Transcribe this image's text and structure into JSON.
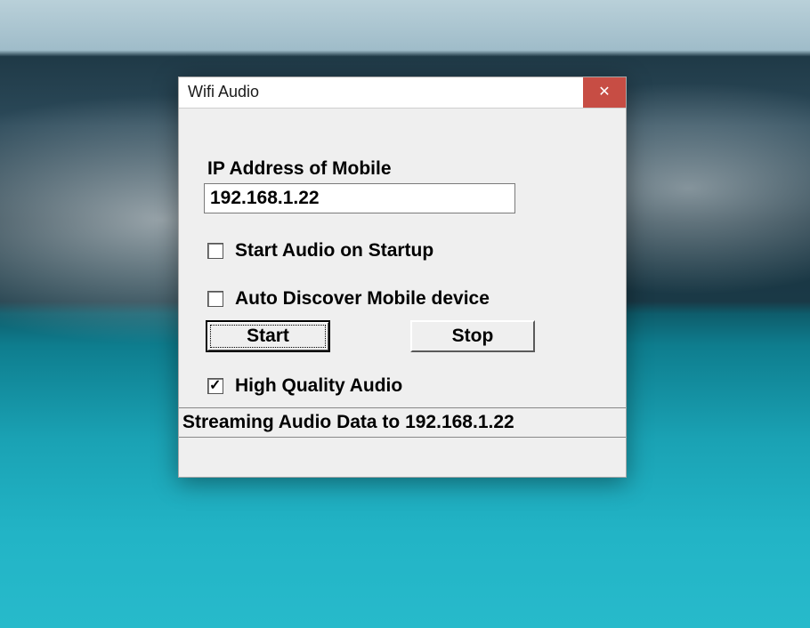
{
  "window": {
    "title": "Wifi Audio",
    "close_glyph": "✕"
  },
  "form": {
    "ip_label": "IP Address of Mobile",
    "ip_value": "192.168.1.22",
    "start_on_startup_label": "Start Audio on Startup",
    "start_on_startup_checked": false,
    "auto_discover_label": "Auto Discover Mobile device",
    "auto_discover_checked": false,
    "start_button": "Start",
    "stop_button": "Stop",
    "high_quality_label": "High Quality Audio",
    "high_quality_checked": true
  },
  "status": {
    "text": "Streaming Audio Data to 192.168.1.22"
  }
}
